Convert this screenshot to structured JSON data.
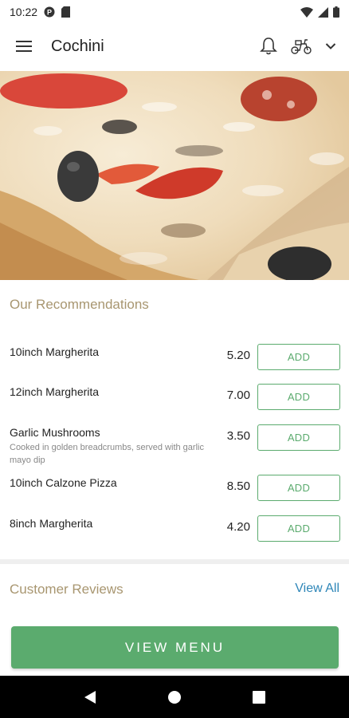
{
  "status_bar": {
    "time": "10:22",
    "icons": [
      "app-notification-icon",
      "sd-card-icon",
      "wifi-icon",
      "signal-icon",
      "battery-icon"
    ]
  },
  "app_bar": {
    "title": "Cochini",
    "icons": [
      "hamburger-menu-icon",
      "bell-icon",
      "scooter-icon",
      "chevron-down-icon"
    ]
  },
  "hero": {
    "image": "pizza-photo"
  },
  "recommendations": {
    "title": "Our Recommendations",
    "items": [
      {
        "name": "10inch Margherita",
        "description": "",
        "price": "5.20",
        "button": "ADD"
      },
      {
        "name": "12inch Margherita",
        "description": "",
        "price": "7.00",
        "button": "ADD"
      },
      {
        "name": "Garlic Mushrooms",
        "description": "Cooked in golden breadcrumbs, served with garlic mayo dip",
        "price": "3.50",
        "button": "ADD"
      },
      {
        "name": "10inch Calzone Pizza",
        "description": "",
        "price": "8.50",
        "button": "ADD"
      },
      {
        "name": "8inch Margherita",
        "description": "",
        "price": "4.20",
        "button": "ADD"
      }
    ]
  },
  "reviews": {
    "title": "Customer Reviews",
    "view_all": "View All"
  },
  "cta": {
    "label": "VIEW MENU"
  },
  "nav_bar": {
    "icons": [
      "back-icon",
      "home-icon",
      "recents-icon"
    ]
  },
  "colors": {
    "accent_green": "#5bab6e",
    "section_title": "#a89670",
    "link_blue": "#2e86b8"
  }
}
